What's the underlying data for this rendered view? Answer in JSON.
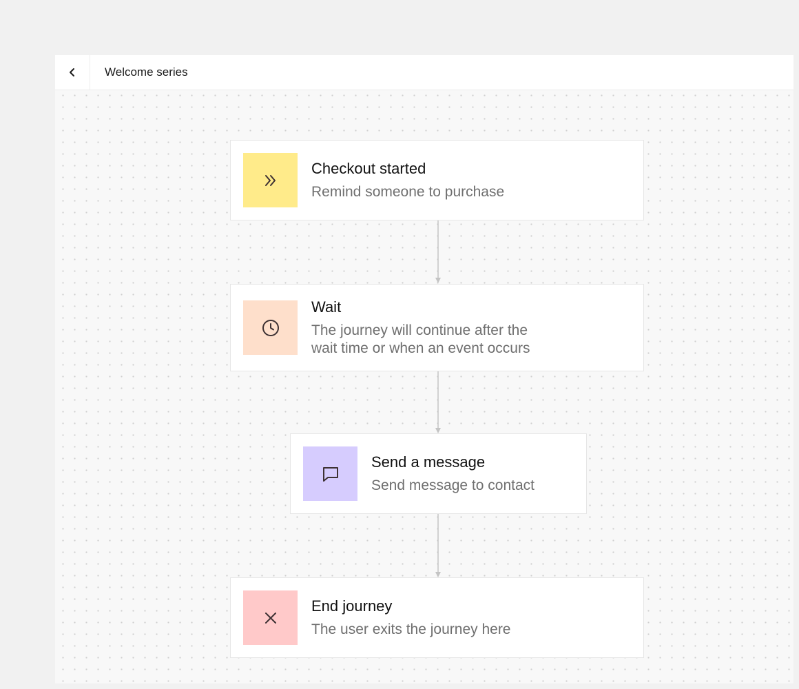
{
  "header": {
    "title": "Welcome series"
  },
  "nodes": [
    {
      "title": "Checkout started",
      "description": "Remind someone to purchase",
      "icon": "double-chevron-right-icon",
      "icon_bg": "#ffeb8a"
    },
    {
      "title": "Wait",
      "description": "The journey will continue after the\nwait time or when an event occurs",
      "icon": "clock-icon",
      "icon_bg": "#fedfcb"
    },
    {
      "title": "Send a message",
      "description": "Send message to contact",
      "icon": "message-bubble-icon",
      "icon_bg": "#d6ccfe"
    },
    {
      "title": "End journey",
      "description": "The user exits the journey here",
      "icon": "close-icon",
      "icon_bg": "#ffc9c9"
    }
  ],
  "colors": {
    "connector": "#c4c4c4",
    "icon_stroke": "#3d3133"
  }
}
